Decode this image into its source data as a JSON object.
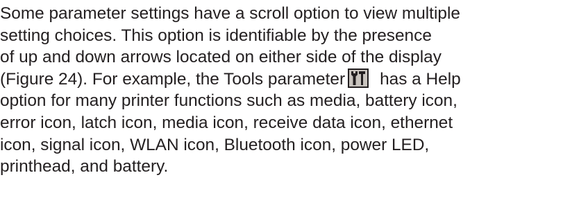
{
  "paragraph": {
    "line1": "Some parameter settings have a scroll option to view multiple",
    "line2": "setting choices. This option is identifiable by the presence",
    "line3": "of up and down arrows located on either side of the display",
    "line4": "(Figure 24). For example, the Tools parameter",
    "line4_after_icon": "has a Help",
    "line5": "option for many printer functions such as media, battery icon,",
    "line6": "error icon, latch icon, media icon, receive data icon, ethernet",
    "line7": "icon, signal icon, WLAN icon, Bluetooth icon, power LED,",
    "line8": "printhead, and battery.",
    "inline_icon": "tools-icon",
    "colors": {
      "text": "#231f20",
      "icon_frame": "#231f20",
      "icon_background": "#c9c4be"
    }
  }
}
